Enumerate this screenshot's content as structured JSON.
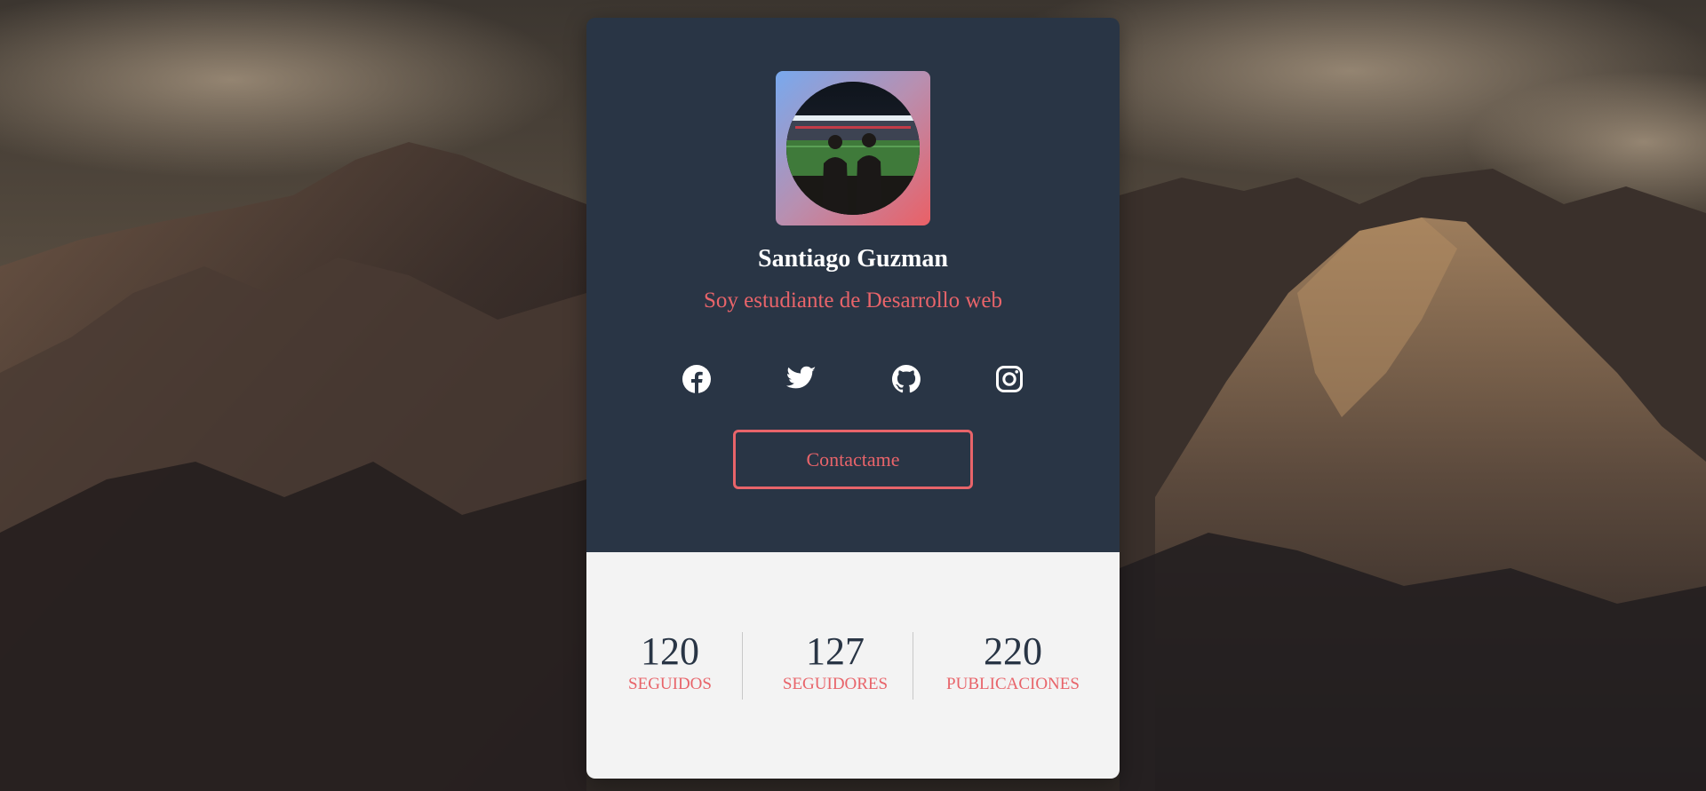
{
  "colors": {
    "card_dark": "#293545",
    "card_light": "#f3f3f3",
    "accent": "#e8646a",
    "name_text": "#ffffff",
    "avatar_gradient_start": "#78a9ee",
    "avatar_gradient_end": "#ea6066"
  },
  "profile": {
    "name": "Santiago Guzman",
    "bio": "Soy estudiante de Desarrollo web",
    "avatar": "profile-photo"
  },
  "social": [
    {
      "icon": "facebook-icon"
    },
    {
      "icon": "twitter-icon"
    },
    {
      "icon": "github-icon"
    },
    {
      "icon": "instagram-icon"
    }
  ],
  "contact_button": {
    "label": "Contactame"
  },
  "stats": [
    {
      "value": "120",
      "label": "SEGUIDOS"
    },
    {
      "value": "127",
      "label": "SEGUIDORES"
    },
    {
      "value": "220",
      "label": "PUBLICACIONES"
    }
  ]
}
